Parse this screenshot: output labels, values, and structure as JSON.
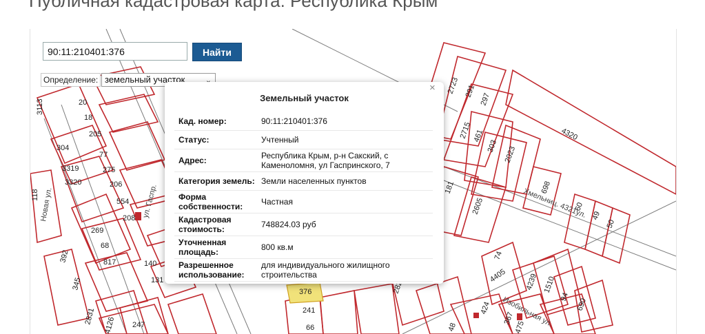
{
  "page": {
    "title": "Публичная кадастровая карта: Республика Крым"
  },
  "search": {
    "value": "90:11:210401:376",
    "button_label": "Найти"
  },
  "definition": {
    "label": "Определение:",
    "selected": "земельный участок"
  },
  "popup": {
    "title": "Земельный участок",
    "close": "×",
    "rows": [
      {
        "key": "Кад. номер:",
        "value": "90:11:210401:376"
      },
      {
        "key": "Статус:",
        "value": "Учтенный"
      },
      {
        "key": "Адрес:",
        "value": "Республика Крым, р-н Сакский, с Каменоломня, ул Гаспринского, 7"
      },
      {
        "key": "Категория земель:",
        "value": "Земли населенных пунктов"
      },
      {
        "key": "Форма собственности:",
        "value": "Частная"
      },
      {
        "key": "Кадастровая стоимость:",
        "value": "748824.03 руб"
      },
      {
        "key": "Уточненная площадь:",
        "value": "800 кв.м"
      },
      {
        "key": "Разрешенное использование:",
        "value": "для индивидуального жилищного строительства"
      }
    ]
  },
  "map": {
    "parcel_labels": [
      "3113",
      "20",
      "18",
      "205",
      "304",
      "77",
      "3319",
      "275",
      "3320",
      "206",
      "554",
      "208",
      "269",
      "68",
      "817",
      "140",
      "131",
      "247",
      "392",
      "345",
      "2831",
      "4126",
      "118",
      "2723",
      "291",
      "297",
      "2715",
      "461",
      "303",
      "2023",
      "4320",
      "181",
      "2605",
      "698",
      "60",
      "49",
      "50",
      "74",
      "4239",
      "1510",
      "94",
      "690",
      "424",
      "367",
      "475",
      "48",
      "282",
      "66",
      "241",
      "376",
      "4405"
    ],
    "streets": [
      "Новая ул.",
      "ул. Гаспр.",
      "Хмельниц. 4321ул.",
      "Изобильная ул."
    ]
  },
  "colors": {
    "parcel": "#c0282d",
    "button": "#1c5b93",
    "highlight": "#f1e27a"
  }
}
